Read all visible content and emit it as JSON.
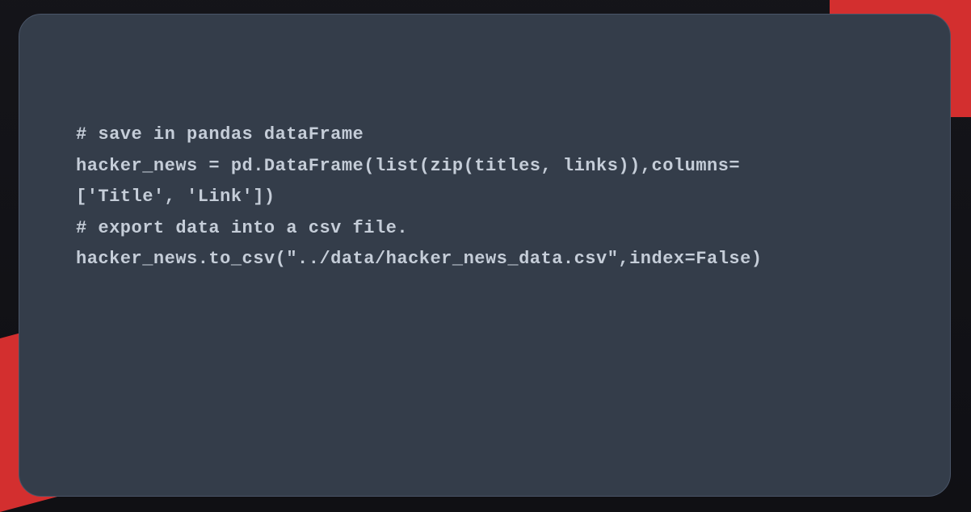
{
  "code": {
    "lines": [
      "# save in pandas dataFrame",
      "hacker_news = pd.DataFrame(list(zip(titles, links)),columns=",
      "['Title', 'Link'])",
      "",
      "# export data into a csv file.",
      "hacker_news.to_csv(\"../data/hacker_news_data.csv\",index=False)"
    ]
  }
}
